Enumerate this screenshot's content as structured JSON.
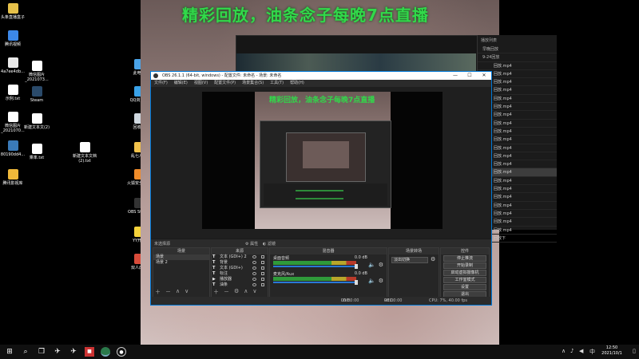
{
  "desktop": {
    "icons_left": [
      {
        "label": "头条直播盒子",
        "color": "#e6c14a"
      },
      {
        "label": "腾讯视频",
        "color": "#3c88e8"
      },
      {
        "label": "4a7ee4db...",
        "color": "#e9e9e9"
      },
      {
        "label": "微信图片_2021073...",
        "color": "#ffffff"
      },
      {
        "label": "示例.txt",
        "color": "#ffffff"
      },
      {
        "label": "Steam",
        "color": "#2a4a6a"
      },
      {
        "label": "微信图片_2021070...",
        "color": "#ffffff"
      },
      {
        "label": "新建文本文(2)",
        "color": "#ffffff"
      },
      {
        "label": "80190dd4...",
        "color": "#3a7ab8"
      },
      {
        "label": "乘率.txt",
        "color": "#ffffff"
      },
      {
        "label": "新建文本文档(2).txt",
        "color": "#ffffff"
      },
      {
        "label": "腾讯影视库",
        "color": "#f0b93a"
      }
    ],
    "icons_mid": [
      {
        "label": "此电脑",
        "color": "#4aa3e8"
      },
      {
        "label": "QQ浏览器",
        "color": "#3aa2e8"
      },
      {
        "label": "回收站",
        "color": "#cfd8e0"
      },
      {
        "label": "乱七八糟",
        "color": "#f1c24b"
      },
      {
        "label": "火狐安全软件",
        "color": "#f08c2a"
      },
      {
        "label": "OBS Studio",
        "color": "#333333"
      },
      {
        "label": "YY开播",
        "color": "#f5d23a"
      },
      {
        "label": "双人成行",
        "color": "#d84b3a"
      }
    ]
  },
  "video_overlay_title": "精彩回放，油条念子每晚7点直播",
  "playlist": {
    "title": "播放列表",
    "items": [
      {
        "label": "早晚回放",
        "type": "folder"
      },
      {
        "label": "9-24回放",
        "type": "folder"
      },
      {
        "label": "回放.mp4",
        "type": "file"
      },
      {
        "label": "回放.mp4",
        "type": "file"
      },
      {
        "label": "回放.mp4",
        "type": "file"
      },
      {
        "label": "回放.mp4",
        "type": "file"
      },
      {
        "label": "回放.mp4",
        "type": "file"
      },
      {
        "label": "回放.mp4",
        "type": "file"
      },
      {
        "label": "回放.mp4",
        "type": "file"
      },
      {
        "label": "回放.mp4",
        "type": "file"
      },
      {
        "label": "回放.mp4",
        "type": "file"
      },
      {
        "label": "回放.mp4",
        "type": "file"
      },
      {
        "label": "回放.mp4",
        "type": "file"
      },
      {
        "label": "回放.mp4",
        "type": "file"
      },
      {
        "label": "回放.mp4",
        "type": "file"
      },
      {
        "label": "回放.mp4",
        "type": "active"
      },
      {
        "label": "回放.mp4",
        "type": "file"
      },
      {
        "label": "回放.mp4",
        "type": "file"
      },
      {
        "label": "回放.mp4",
        "type": "file"
      },
      {
        "label": "回放.mp4",
        "type": "file"
      },
      {
        "label": "回放.mp4",
        "type": "file"
      },
      {
        "label": "回放.mp4",
        "type": "file"
      },
      {
        "label": "回放.mp4",
        "type": "file"
      },
      {
        "label": "回放下",
        "type": "file"
      }
    ]
  },
  "obs": {
    "title": "OBS 26.1.1 (64-bit, windows) - 配置文件: 未命名 - 场景: 未命名",
    "menu": [
      "文件(F)",
      "编辑(E)",
      "视图(V)",
      "配置文件(P)",
      "场景集合(S)",
      "工具(T)",
      "帮助(H)"
    ],
    "preview_title": "精彩回放，油条念子每晚7点直播",
    "no_source_label": "未选择源",
    "properties_label": "属性",
    "filters_label": "滤镜",
    "docks": {
      "scenes": {
        "title": "场景",
        "items": [
          "场景",
          "场景 2"
        ]
      },
      "sources": {
        "title": "来源",
        "items": [
          {
            "icon": "T",
            "label": "文本 (GDI+) 2"
          },
          {
            "icon": "T",
            "label": "背景"
          },
          {
            "icon": "T",
            "label": "文本 (GDI+)"
          },
          {
            "icon": "T",
            "label": "标注"
          },
          {
            "icon": "▶",
            "label": "播放器"
          },
          {
            "icon": "T",
            "label": "油条"
          }
        ]
      },
      "mixer": {
        "title": "混音器",
        "channels": [
          {
            "name": "桌面音频",
            "db": "0.0 dB"
          },
          {
            "name": "麦克风/Aux",
            "db": "0.0 dB"
          }
        ]
      },
      "transitions": {
        "title": "场景转场",
        "value": "淡出切换"
      },
      "controls": {
        "title": "控件",
        "buttons": [
          "停止推流",
          "开始录制",
          "启动虚拟摄像机",
          "工作室模式",
          "设置",
          "退出"
        ]
      }
    },
    "status": {
      "live_label": "LIVE:",
      "live_time": "00:00:00",
      "rec_label": "REC:",
      "rec_time": "00:00:00",
      "cpu": "CPU: 7%, 40.00 fps"
    }
  },
  "taskbar": {
    "time": "12:50",
    "date": "2021/10/1",
    "lang": "中"
  }
}
